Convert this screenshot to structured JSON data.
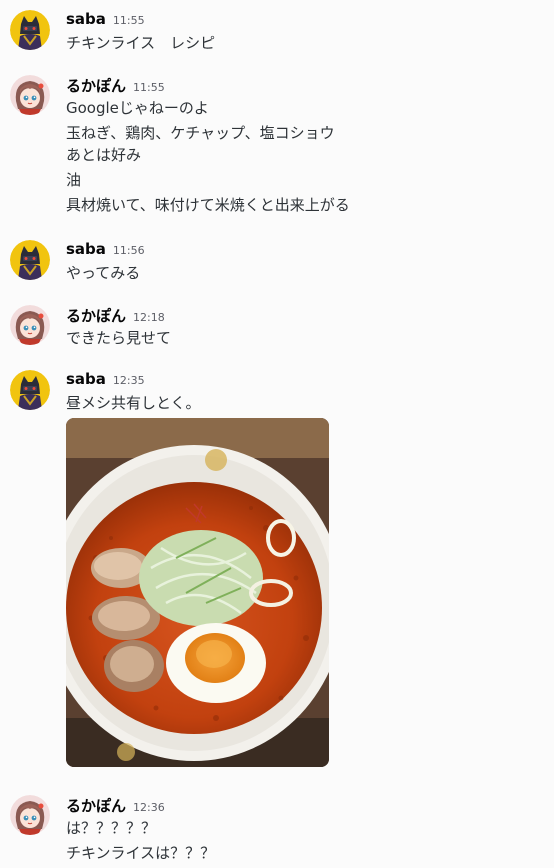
{
  "users": {
    "saba": {
      "name": "saba",
      "avatar_icon": "dark-cat-avatar-icon",
      "avatar_bg": "#f1c40f"
    },
    "rukapon": {
      "name": "るかぽん",
      "avatar_icon": "anime-girl-avatar-icon",
      "avatar_bg": "#f2dcdc"
    }
  },
  "messages": [
    {
      "user": "saba",
      "time": "11:55",
      "lines": [
        "チキンライス　レシピ"
      ]
    },
    {
      "user": "るかぽん",
      "time": "11:55",
      "lines": [
        "Googleじゃねーのよ",
        "玉ねぎ、鶏肉、ケチャップ、塩コショウ",
        "あとは好み",
        "油",
        "具材焼いて、味付けて米焼くと出来上がる"
      ]
    },
    {
      "user": "saba",
      "time": "11:56",
      "lines": [
        "やってみる"
      ]
    },
    {
      "user": "るかぽん",
      "time": "12:18",
      "lines": [
        "できたら見せて"
      ]
    },
    {
      "user": "saba",
      "time": "12:35",
      "lines": [
        "昼メシ共有しとく。"
      ],
      "attachment": "ramen-photo"
    },
    {
      "user": "るかぽん",
      "time": "12:36",
      "lines": [
        "は？？？？？",
        "チキンライスは？？？"
      ]
    }
  ]
}
